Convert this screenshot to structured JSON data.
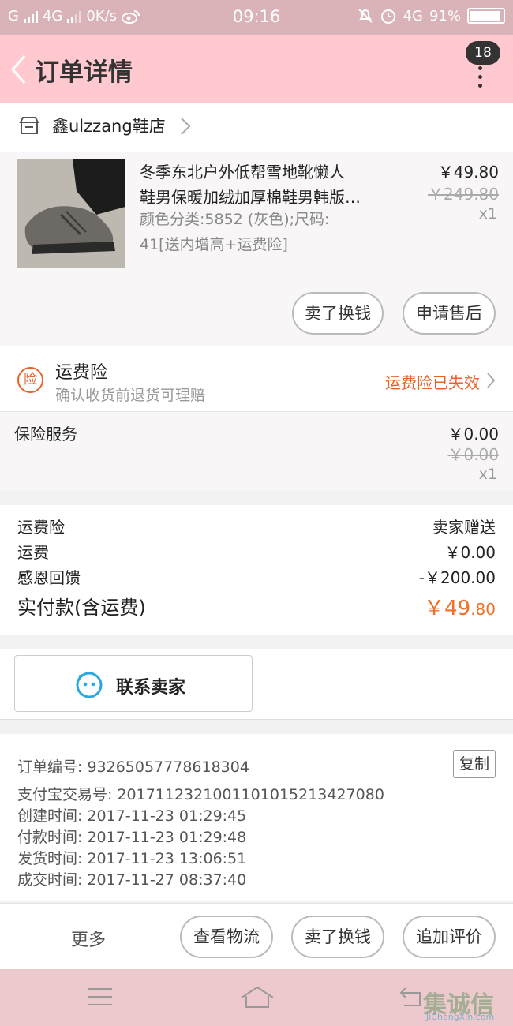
{
  "status_bar": {
    "carrier": "G",
    "network1": "4G",
    "speed": "0K/s",
    "time": "09:16",
    "network2": "4G",
    "battery": "91%"
  },
  "header": {
    "title": "订单详情",
    "badge": "18"
  },
  "shop": {
    "name": "鑫ulzzang鞋店"
  },
  "product": {
    "title_line1": "冬季东北户外低帮雪地靴懒人",
    "title_line2": "鞋男保暖加绒加厚棉鞋男韩版…",
    "spec_line1": "颜色分类:5852 (灰色);尺码:",
    "spec_line2": "41[送内增高+运费险]",
    "price": "￥49.80",
    "original_price": "￥249.80",
    "qty": "x1",
    "btn_exchange": "卖了换钱",
    "btn_after_sale": "申请售后"
  },
  "insurance": {
    "icon_text": "险",
    "title": "运费险",
    "desc": "确认收货前退货可理赔",
    "status": "运费险已失效"
  },
  "service": {
    "label": "保险服务",
    "price": "￥0.00",
    "original_price": "￥0.00",
    "qty": "x1"
  },
  "totals": {
    "ins_label": "运费险",
    "ins_value": "卖家赠送",
    "ship_label": "运费",
    "ship_value": "￥0.00",
    "refund_label": "感恩回馈",
    "refund_value": "-￥200.00",
    "paid_label": "实付款(含运费)",
    "paid_value_int": "￥49",
    "paid_value_dec": ".80"
  },
  "contact": {
    "label": "联系卖家"
  },
  "order_info": {
    "order_no": "订单编号: 93265057778618304",
    "copy": "复制",
    "alipay_no": "支付宝交易号: 2017112321001101015213427080",
    "created": "创建时间: 2017-11-23  01:29:45",
    "paid": "付款时间: 2017-11-23  01:29:48",
    "shipped": "发货时间: 2017-11-23  13:06:51",
    "closed": "成交时间: 2017-11-27  08:37:40"
  },
  "actions": {
    "more": "更多",
    "logistics": "查看物流",
    "sell": "卖了换钱",
    "review": "追加评价"
  },
  "watermark": {
    "text": "集诚信",
    "url": "JiChengXin.com"
  },
  "colors": {
    "header_bg": "#ffc9cf",
    "status_bg": "#d9b3b8",
    "accent_orange": "#f07028"
  }
}
